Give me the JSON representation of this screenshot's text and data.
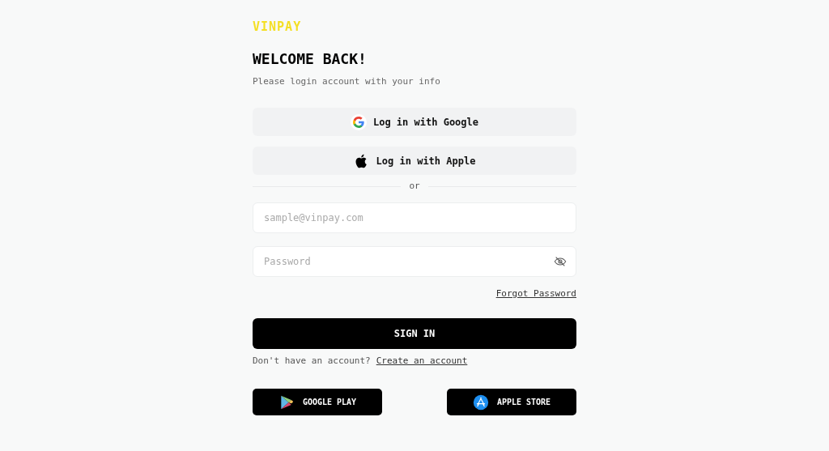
{
  "logo": "VINPAY",
  "title": "WELCOME BACK!",
  "subtitle": "Please login account with your info",
  "social_buttons": [
    {
      "kind": "google",
      "label": "Log in with Google"
    },
    {
      "kind": "apple",
      "label": "Log in with Apple"
    }
  ],
  "divider": "or",
  "email": {
    "placeholder": "sample@vinpay.com"
  },
  "password": {
    "placeholder": "Password"
  },
  "forgot_link": "Forgot Password",
  "sign_in_button": "SIGN IN",
  "signup": {
    "prompt": "Don't have an account?",
    "link": "Create an account"
  },
  "store_buttons": [
    {
      "kind": "google_play",
      "label": "GOOGLE PLAY"
    },
    {
      "kind": "app_store",
      "label": "APPLE STORE"
    }
  ]
}
